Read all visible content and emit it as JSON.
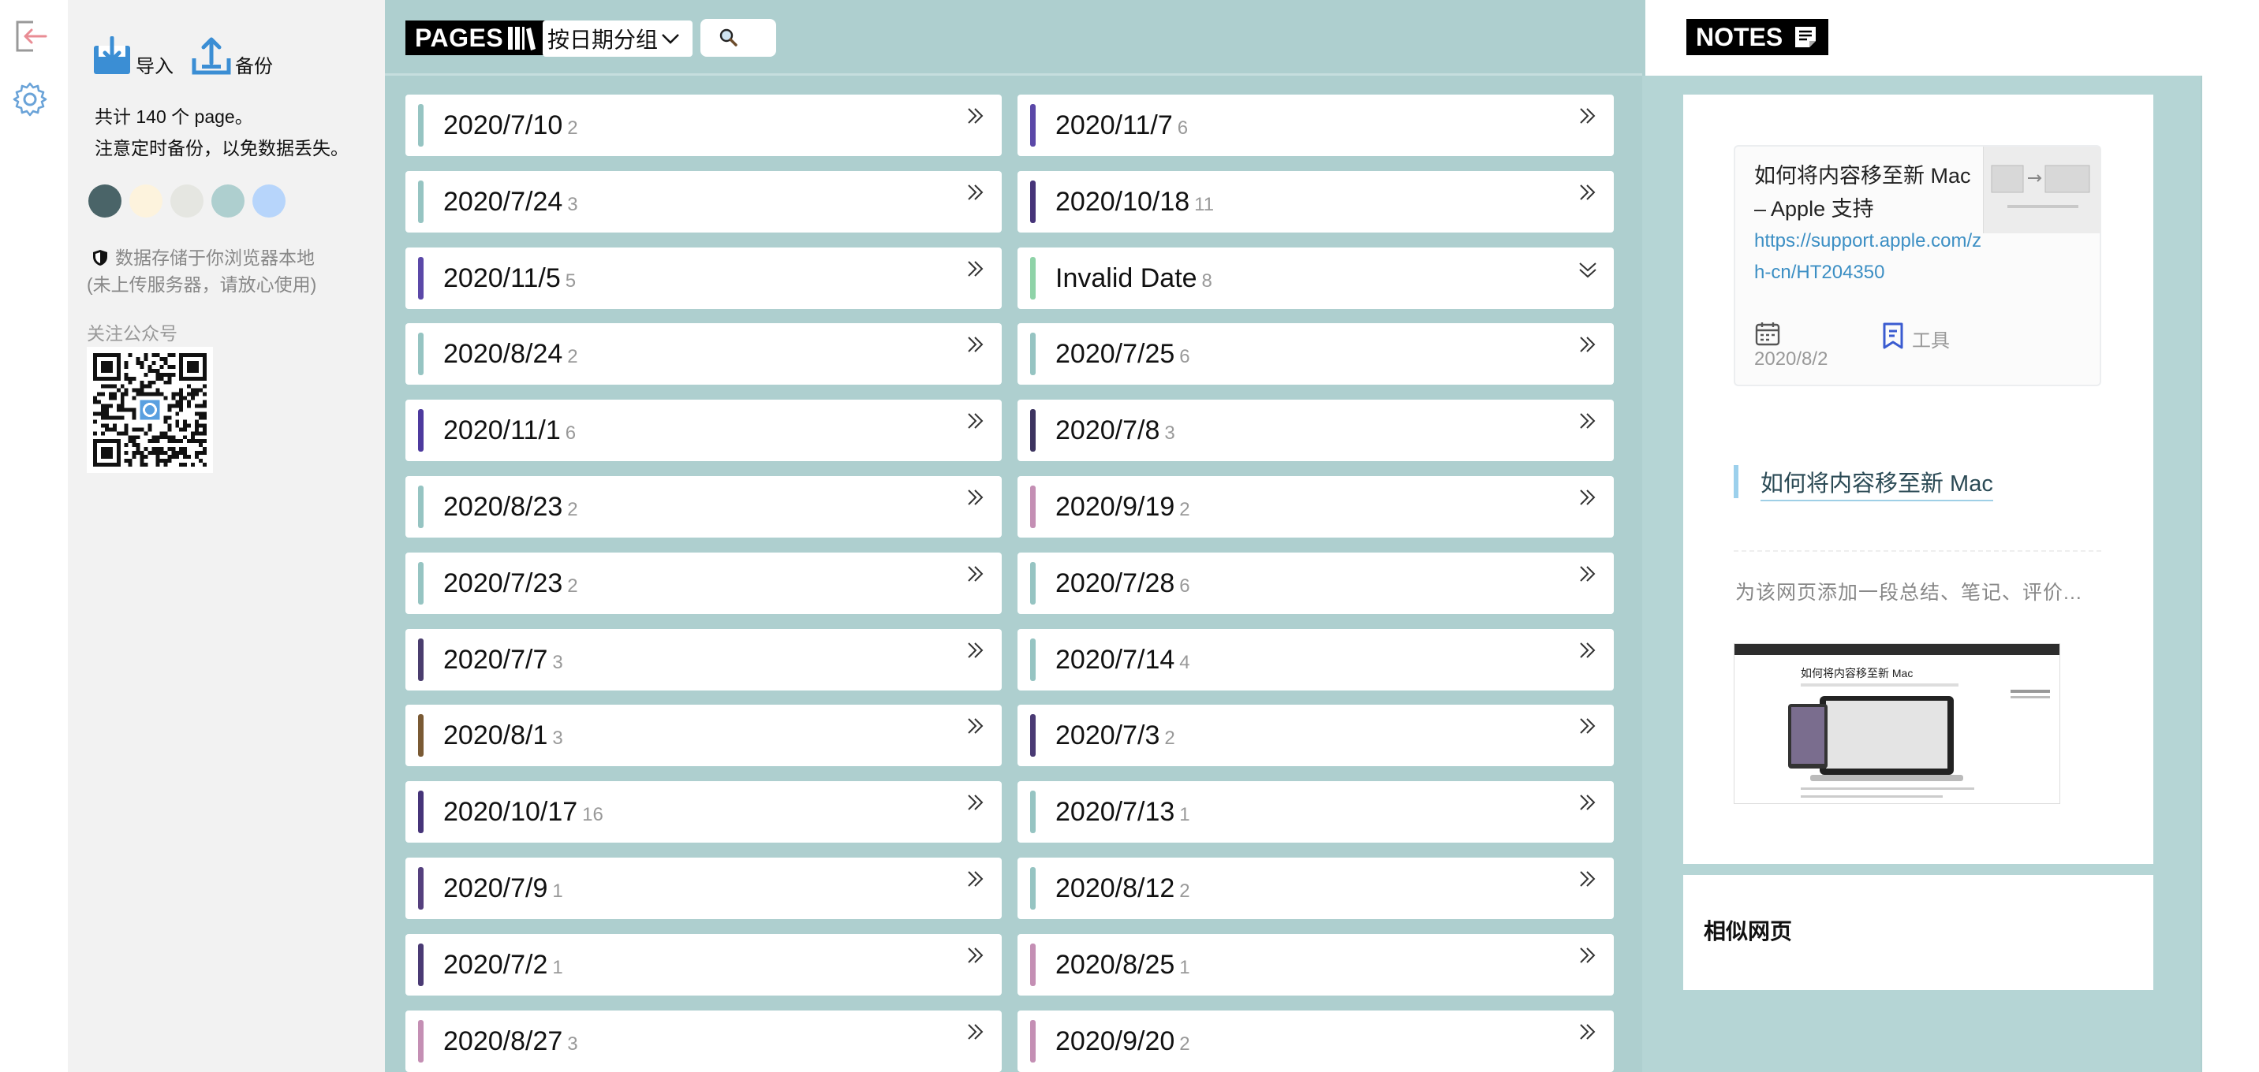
{
  "rail": {
    "logout_icon": "logout-icon",
    "settings_icon": "gear-icon"
  },
  "settings": {
    "import_label": "导入",
    "backup_label": "备份",
    "count_line": "共计 140 个 page。",
    "backup_reminder": "注意定时备份，以免数据丢失。",
    "theme_colors": [
      "#4a6468",
      "#fdf3dd",
      "#e5e6e1",
      "#aecfcf",
      "#b7d5fb"
    ],
    "storage_line1": "数据存储于你浏览器本地",
    "storage_line2": "(未上传服务器，请放心使用)",
    "follow_label": "关注公众号"
  },
  "pages": {
    "brand": "PAGES",
    "group_by": "按日期分组",
    "search_icon": "search-icon",
    "left_column": [
      {
        "date": "2020/7/10",
        "count": "2",
        "color": "#96c4c2"
      },
      {
        "date": "2020/7/24",
        "count": "3",
        "color": "#96c4c2"
      },
      {
        "date": "2020/11/5",
        "count": "5",
        "color": "#5b48a8"
      },
      {
        "date": "2020/8/24",
        "count": "2",
        "color": "#96c4c2"
      },
      {
        "date": "2020/11/1",
        "count": "6",
        "color": "#4d3a9e"
      },
      {
        "date": "2020/8/23",
        "count": "2",
        "color": "#96c4c2"
      },
      {
        "date": "2020/7/23",
        "count": "2",
        "color": "#96c4c2"
      },
      {
        "date": "2020/7/7",
        "count": "3",
        "color": "#4a3d6e"
      },
      {
        "date": "2020/8/1",
        "count": "3",
        "color": "#7a5a34"
      },
      {
        "date": "2020/10/17",
        "count": "16",
        "color": "#463479"
      },
      {
        "date": "2020/7/9",
        "count": "1",
        "color": "#55407e"
      },
      {
        "date": "2020/7/2",
        "count": "1",
        "color": "#4a3a74"
      },
      {
        "date": "2020/8/27",
        "count": "3",
        "color": "#c48fb4"
      }
    ],
    "right_column": [
      {
        "date": "2020/11/7",
        "count": "6",
        "color": "#5b48a8"
      },
      {
        "date": "2020/10/18",
        "count": "11",
        "color": "#463479"
      },
      {
        "date": "Invalid Date",
        "count": "8",
        "color": "#8fd3a8",
        "expanded": true
      },
      {
        "date": "2020/7/25",
        "count": "6",
        "color": "#96c4c2"
      },
      {
        "date": "2020/7/8",
        "count": "3",
        "color": "#3d3460"
      },
      {
        "date": "2020/9/19",
        "count": "2",
        "color": "#c48fb4"
      },
      {
        "date": "2020/7/28",
        "count": "6",
        "color": "#96c4c2"
      },
      {
        "date": "2020/7/14",
        "count": "4",
        "color": "#96c4c2"
      },
      {
        "date": "2020/7/3",
        "count": "2",
        "color": "#4a3a74"
      },
      {
        "date": "2020/7/13",
        "count": "1",
        "color": "#96c4c2"
      },
      {
        "date": "2020/8/12",
        "count": "2",
        "color": "#96c4c2"
      },
      {
        "date": "2020/8/25",
        "count": "1",
        "color": "#c48fb4"
      },
      {
        "date": "2020/9/20",
        "count": "2",
        "color": "#c48fb4"
      }
    ]
  },
  "notes": {
    "brand": "NOTES",
    "link_title": "如何将内容移至新 Mac – Apple 支持",
    "link_url": "https://support.apple.com/zh-cn/HT204350",
    "date": "2020/8/2",
    "tag": "工具",
    "heading": "如何将内容移至新 Mac",
    "placeholder": "为该网页添加一段总结、笔记、评价...",
    "shot_heading": "如何将内容移至新 Mac",
    "similar_title": "相似网页"
  }
}
